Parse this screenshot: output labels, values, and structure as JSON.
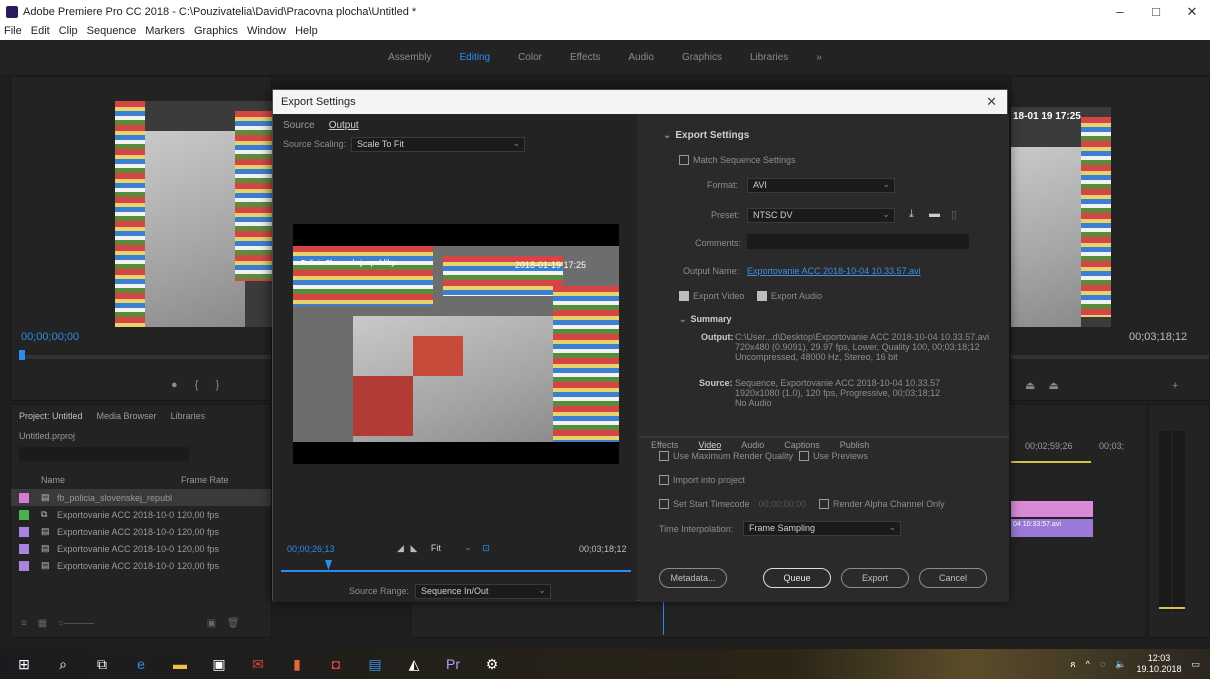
{
  "window": {
    "title": "Adobe Premiere Pro CC 2018 - C:\\Pouzivatelia\\David\\Pracovna plocha\\Untitled *",
    "controls": [
      "–",
      "□",
      "✕"
    ]
  },
  "menu": [
    "File",
    "Edit",
    "Clip",
    "Sequence",
    "Markers",
    "Graphics",
    "Window",
    "Help"
  ],
  "workspaces": [
    "Assembly",
    "Editing",
    "Color",
    "Effects",
    "Audio",
    "Graphics",
    "Libraries"
  ],
  "active_workspace": "Editing",
  "source_monitor": {
    "timecode": "00;00;00;00"
  },
  "program_monitor": {
    "overlay_time": "18-01 19 17:25",
    "timecode": "00;03;18;12"
  },
  "project_panel": {
    "tabs": [
      "Project: Untitled",
      "Media Browser",
      "Libraries"
    ],
    "project_file": "Untitled.prproj",
    "columns": [
      "Name",
      "Frame Rate"
    ],
    "items": [
      {
        "name": "fb_policia_slovenskej_republ",
        "fps": "",
        "color": "#d47ad4",
        "selected": true
      },
      {
        "name": "Exportovanie ACC 2018-10-0",
        "fps": "120,00 fps",
        "color": "#4caf50",
        "selected": false
      },
      {
        "name": "Exportovanie ACC 2018-10-0",
        "fps": "120,00 fps",
        "color": "#a784e0",
        "selected": false
      },
      {
        "name": "Exportovanie ACC 2018-10-0",
        "fps": "120,00 fps",
        "color": "#a784e0",
        "selected": false
      },
      {
        "name": "Exportovanie ACC 2018-10-0",
        "fps": "120,00 fps",
        "color": "#a784e0",
        "selected": false
      }
    ]
  },
  "timeline": {
    "time1": "00;02;59;26",
    "time2": "00;03;",
    "clip_label": "04 10:33:57.avi"
  },
  "dialog": {
    "title": "Export Settings",
    "tabs": [
      "Source",
      "Output"
    ],
    "active_tab": "Output",
    "source_scaling_label": "Source Scaling:",
    "source_scaling_value": "Scale To Fit",
    "preview_overlay_time": "2018-01-19 17:25",
    "preview_logo": "Policia Slovenskej republiky",
    "current_time": "00;00;26;13",
    "end_time": "00;03;18;12",
    "fit_value": "Fit",
    "source_range_label": "Source Range:",
    "source_range_value": "Sequence In/Out",
    "export_settings_header": "Export Settings",
    "match_sequence": "Match Sequence Settings",
    "format_label": "Format:",
    "format_value": "AVI",
    "preset_label": "Preset:",
    "preset_value": "NTSC DV",
    "comments_label": "Comments:",
    "output_name_label": "Output Name:",
    "output_name_value": "Exportovanie ACC 2018-10-04 10.33.57.avi",
    "export_video": "Export Video",
    "export_audio": "Export Audio",
    "summary_header": "Summary",
    "output_label": "Output:",
    "output_lines": [
      "C:\\User...d\\Desktop\\Exportovanie ACC 2018-10-04 10.33.57.avi",
      "720x480 (0.9091), 29.97 fps, Lower, Quality 100, 00;03;18;12",
      "Uncompressed, 48000 Hz, Stereo, 16 bit"
    ],
    "source_label": "Source:",
    "source_lines": [
      "Sequence, Exportovanie ACC 2018-10-04 10.33.57",
      "1920x1080 (1.0), 120 fps, Progressive, 00;03;18;12",
      "No Audio"
    ],
    "lower_tabs": [
      "Effects",
      "Video",
      "Audio",
      "Captions",
      "Publish"
    ],
    "use_max_render": "Use Maximum Render Quality",
    "use_previews": "Use Previews",
    "import_into_project": "Import into project",
    "set_start_timecode": "Set Start Timecode",
    "start_timecode_value": "00;00;00;00",
    "render_alpha": "Render Alpha Channel Only",
    "time_interp_label": "Time Interpolation:",
    "time_interp_value": "Frame Sampling",
    "buttons": {
      "metadata": "Metadata...",
      "queue": "Queue",
      "export": "Export",
      "cancel": "Cancel"
    }
  },
  "taskbar": {
    "clock_time": "12:03",
    "clock_date": "19.10.2018"
  }
}
